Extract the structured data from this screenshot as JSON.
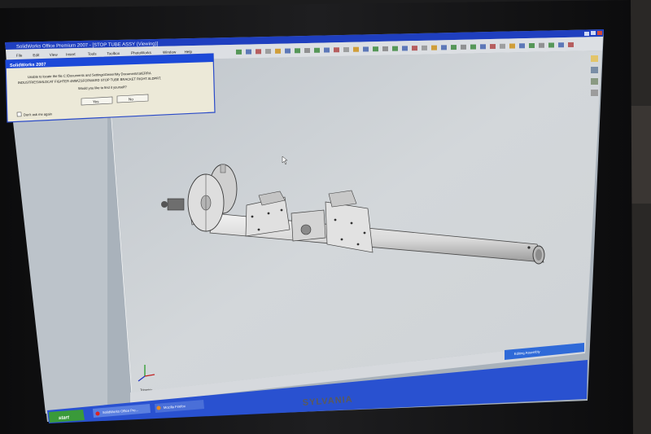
{
  "window": {
    "title": "SolidWorks Office Premium 2007 - [STOP TUBE ASSY (Viewing)]",
    "menu": [
      "File",
      "Edit",
      "View",
      "Insert",
      "Tools",
      "Toolbox",
      "PhotoWorks",
      "Window",
      "Help"
    ]
  },
  "dialog": {
    "title": "SolidWorks 2007",
    "message_line1": "Unable to locate the file C:\\Documents and Settings\\Owner\\My Documents\\SIERRA",
    "message_line2": "INDUSTRIES\\WILDCAT FIGHTER 4MM\\ZSFORWARD STOP TUBE BRACKET RIGHT.SLDPRT.",
    "message_line3": "Would you like to find it yourself?",
    "yes_label": "Yes",
    "no_label": "No",
    "checkbox_label": "Don't ask me again"
  },
  "taskbar": {
    "start_label": "start",
    "task1_label": "SolidWorks Office Pre...",
    "task2_label": "Mozilla Firefox"
  },
  "status_bar": {
    "text": "Editing Assembly"
  },
  "triad": {
    "label": "Trimetric"
  },
  "monitor": {
    "brand": "SYLVANIA"
  },
  "colors": {
    "title_bar": "#1f3fbf",
    "dialog_title": "#1c49d8",
    "viewport": "#c9cdd1",
    "taskbar": "#2951d0",
    "start_button": "#3a9a3a"
  }
}
